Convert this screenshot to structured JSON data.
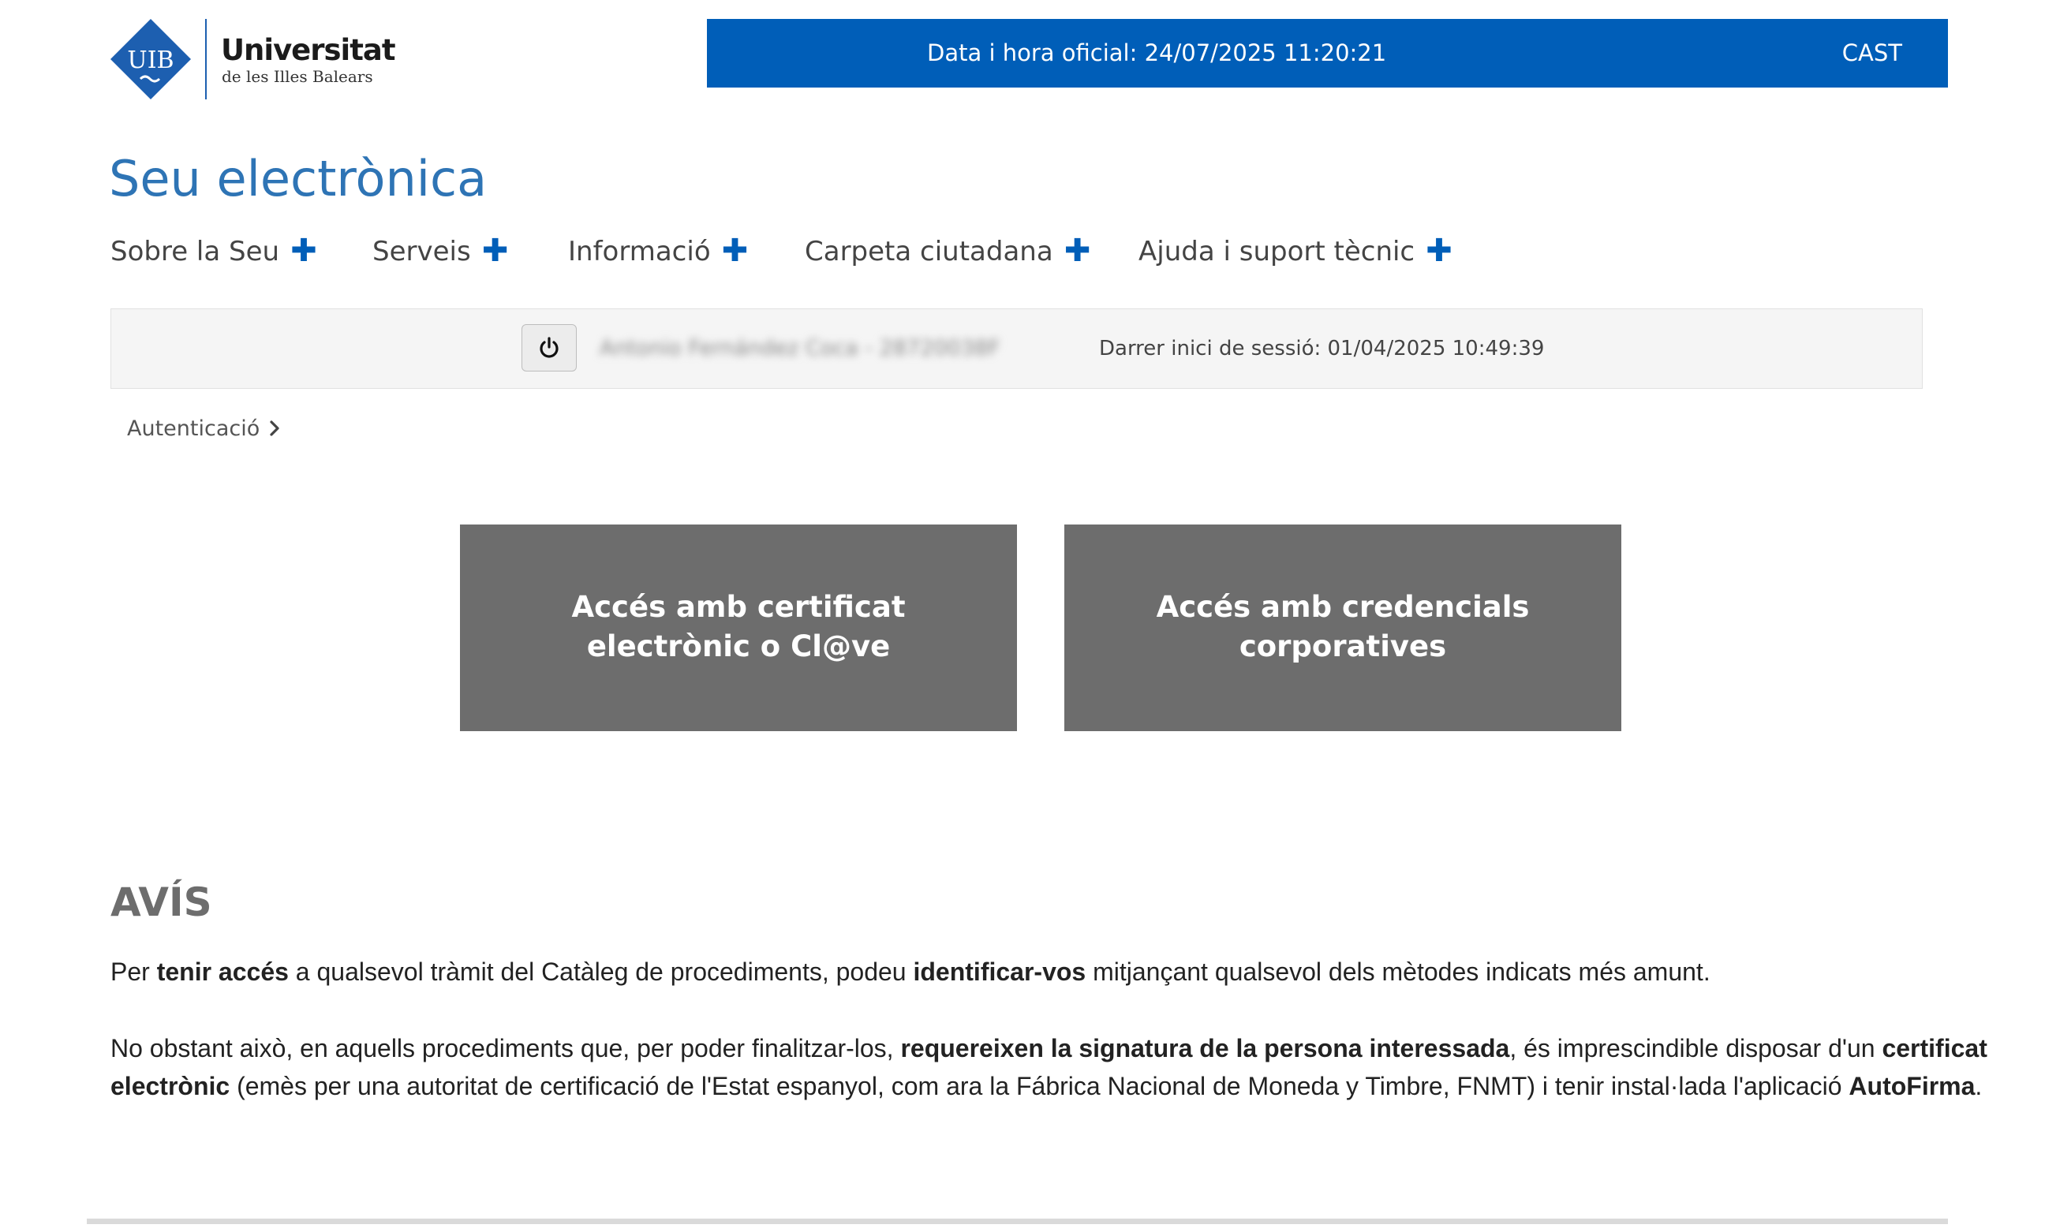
{
  "header": {
    "logo_text": "UIB",
    "university_name": "Universitat",
    "university_subtitle": "de les Illes Balears",
    "datetime_text": "Data i hora oficial: 24/07/2025  11:20:21",
    "language_link": "CAST",
    "bar_color": "#005eb8"
  },
  "site_title": "Seu electrònica",
  "nav": {
    "items": [
      {
        "label": "Sobre la Seu",
        "icon": "plus-icon"
      },
      {
        "label": "Serveis",
        "icon": "plus-icon"
      },
      {
        "label": "Informació",
        "icon": "plus-icon"
      },
      {
        "label": "Carpeta ciutadana",
        "icon": "plus-icon"
      },
      {
        "label": "Ajuda i suport tècnic",
        "icon": "plus-icon"
      }
    ]
  },
  "session": {
    "user_name": "Antonio Fernández Coca - 28720038F",
    "last_login": "Darrer inici de sessió: 01/04/2025 10:49:39",
    "logout_icon": "power-icon"
  },
  "breadcrumb": {
    "label": "Autenticació",
    "icon": "chevron-right-icon"
  },
  "access": {
    "certificate_label": "Accés amb certificat electrònic o Cl@ve",
    "corporate_label": "Accés amb credencials corporatives"
  },
  "notice": {
    "title": "AVÍS",
    "p1": {
      "a": "Per ",
      "b": "tenir accés",
      "c": " a qualsevol tràmit del Catàleg de procediments, podeu ",
      "d": "identificar-vos",
      "e": " mitjançant qualsevol dels mètodes indicats més amunt."
    },
    "p2": {
      "a": "No obstant això, en aquells procediments que, per poder finalitzar-los, ",
      "b": "requereixen la signatura de la persona interessada",
      "c": ", és imprescindible disposar d'un ",
      "d": "certificat electrònic",
      "e": " (emès per una autoritat de certificació de l'Estat espanyol, com ara la Fábrica Nacional de Moneda y Timbre, FNMT) i tenir instal·lada l'aplicació ",
      "f": "AutoFirma",
      "g": "."
    }
  }
}
